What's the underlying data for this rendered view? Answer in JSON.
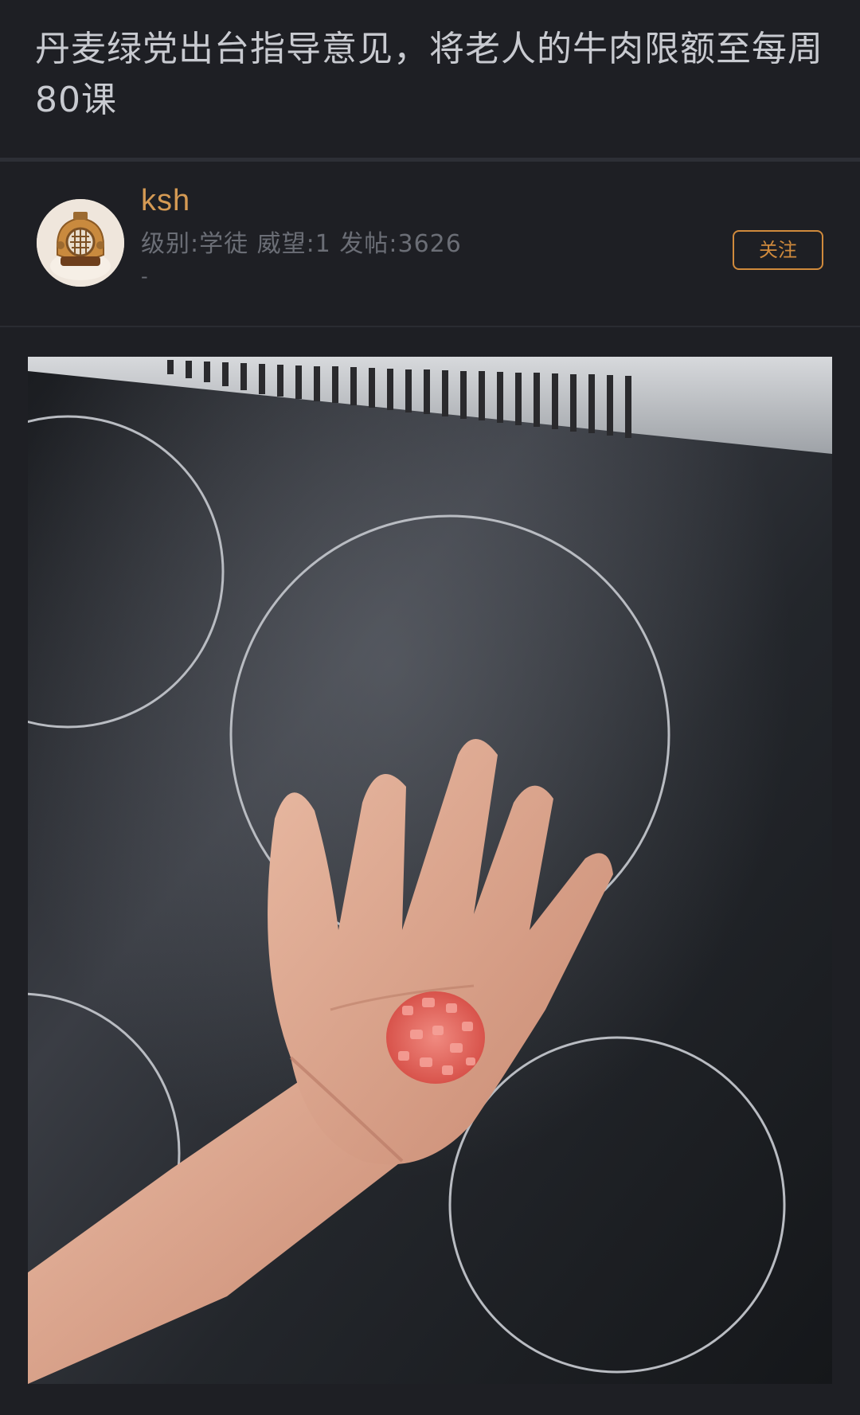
{
  "post": {
    "title": "丹麦绿党出台指导意见，将老人的牛肉限额至每周80课"
  },
  "author": {
    "name": "ksh",
    "meta": "级别:学徒  威望:1  发帖:3626",
    "sub": "-",
    "follow_label": "关注",
    "avatar_icon": "diving-helmet-icon"
  },
  "colors": {
    "background": "#1e1f24",
    "accent": "#d08a3c",
    "username": "#d59a54",
    "muted_text": "#6b6e76"
  }
}
